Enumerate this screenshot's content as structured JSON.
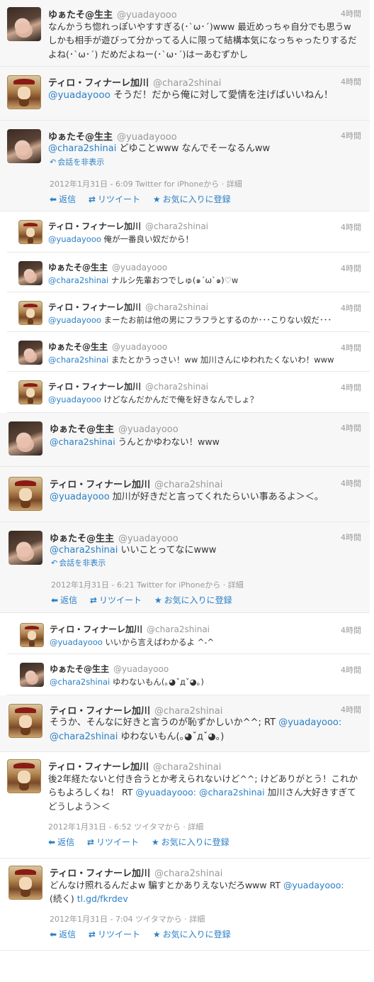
{
  "tweets": [
    {
      "name": "ゆぁたそ@生主",
      "handle": "@yuadayooo",
      "time": "4時間",
      "text": "なんかうち惚れっぽいやすすぎる(･`ω･´)www 最近めっちゃ自分でも思うw しかも相手が遊びって分かってる人に限って結構本気になっちゃったりするだよね(･`ω･´) だめだよねー(･`ω･´)はーあむずかし"
    },
    {
      "name": "ティロ・フィナーレ加川",
      "handle": "@chara2shinai",
      "time": "4時間",
      "mention": "@yuadayooo",
      "text": " そうだ！だから俺に対して愛情を注げばいいねん！"
    },
    {
      "name": "ゆぁたそ@生主",
      "handle": "@yuadayooo",
      "time": "4時間",
      "mention": "@chara2shinai",
      "text": " どゆことwww なんでそーなるんww",
      "hide": "会話を非表示",
      "meta": "2012年1月31日 - 6:09 Twitter for iPhoneから · 詳細",
      "reply": "返信",
      "retweet": "リツイート",
      "fav": "お気に入りに登録"
    },
    {
      "name": "ティロ・フィナーレ加川",
      "handle": "@chara2shinai",
      "time": "4時間",
      "mention": "@yuadayooo",
      "text": " 俺が一番良い奴だから！"
    },
    {
      "name": "ゆぁたそ@生主",
      "handle": "@yuadayooo",
      "time": "4時間",
      "mention": "@chara2shinai",
      "text": " ナルシ先輩おつでしゅ(๑´ω`๑)♡w"
    },
    {
      "name": "ティロ・フィナーレ加川",
      "handle": "@chara2shinai",
      "time": "4時間",
      "mention": "@yuadayooo",
      "text": " まーたお前は他の男にフラフラとするのか･･･こりない奴だ･･･"
    },
    {
      "name": "ゆぁたそ@生主",
      "handle": "@yuadayooo",
      "time": "4時間",
      "mention": "@chara2shinai",
      "text": " またとかうっさい！ww 加川さんにゆわれたくないわ！www"
    },
    {
      "name": "ティロ・フィナーレ加川",
      "handle": "@chara2shinai",
      "time": "4時間",
      "mention": "@yuadayooo",
      "text": " けどなんだかんだで俺を好きなんでしょ？"
    },
    {
      "name": "ゆぁたそ@生主",
      "handle": "@yuadayooo",
      "time": "4時間",
      "mention": "@chara2shinai",
      "text": " うんとかゆわない！www"
    },
    {
      "name": "ティロ・フィナーレ加川",
      "handle": "@chara2shinai",
      "time": "4時間",
      "mention": "@yuadayooo",
      "text": " 加川が好きだと言ってくれたらいい事あるよ＞＜。"
    },
    {
      "name": "ゆぁたそ@生主",
      "handle": "@yuadayooo",
      "time": "4時間",
      "mention": "@chara2shinai",
      "text": " いいことってなにwww",
      "hide": "会話を非表示",
      "meta": "2012年1月31日 - 6:21 Twitter for iPhoneから · 詳細",
      "reply": "返信",
      "retweet": "リツイート",
      "fav": "お気に入りに登録"
    },
    {
      "name": "ティロ・フィナーレ加川",
      "handle": "@chara2shinai",
      "time": "4時間",
      "mention": "@yuadayooo",
      "text": " いいから言えばわかるよ ^-^"
    },
    {
      "name": "ゆぁたそ@生主",
      "handle": "@yuadayooo",
      "time": "4時間",
      "mention": "@chara2shinai",
      "text": " ゆわないもん(｡◕ˇдˇ◕｡)"
    },
    {
      "name": "ティロ・フィナーレ加川",
      "handle": "@chara2shinai",
      "time": "4時間",
      "text": "そうか、そんなに好きと言うのが恥ずかしいか^^; RT ",
      "mention": "@yuadayooo:",
      "mention2": "@chara2shinai",
      "text2": " ゆわないもん(｡◕ˇдˇ◕｡)"
    },
    {
      "name": "ティロ・フィナーレ加川",
      "handle": "@chara2shinai",
      "time": "",
      "text": "後2年経たないと付き合うとか考えられないけど^^; けどありがとう！これからもよろしくね！ RT ",
      "mention": "@yuadayooo:",
      "mention2": "@chara2shinai",
      "text2": " 加川さん大好きすぎてどうしよう＞＜",
      "meta": "2012年1月31日 - 6:52 ツイタマから · 詳細",
      "reply": "返信",
      "retweet": "リツイート",
      "fav": "お気に入りに登録"
    },
    {
      "name": "ティロ・フィナーレ加川",
      "handle": "@chara2shinai",
      "time": "",
      "text": "どんなけ照れるんだよw 騙すとかありえないだろwww RT ",
      "mention": "@yuadayooo:",
      "text2": "(続く) ",
      "link": "tl.gd/fkrdev",
      "meta": "2012年1月31日 - 7:04 ツイタマから · 詳細",
      "reply": "返信",
      "retweet": "リツイート",
      "fav": "お気に入りに登録"
    }
  ],
  "colors": {
    "link": "#2a7fc6",
    "muted": "#999999",
    "text": "#333333",
    "bg": "#f7f7f7"
  }
}
